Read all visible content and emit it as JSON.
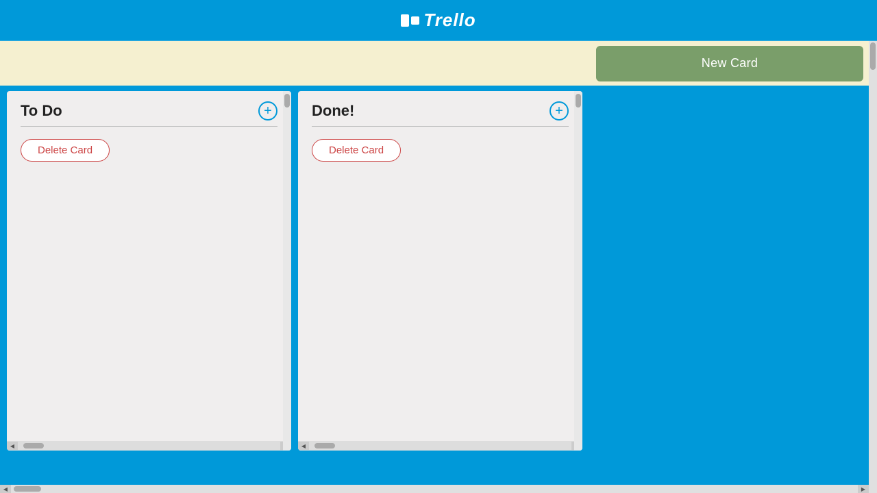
{
  "header": {
    "logo_text": "Trello"
  },
  "toolbar": {
    "new_card_label": "New Card",
    "background_color": "#f5f0d0"
  },
  "board": {
    "background_color": "#0099d9",
    "columns": [
      {
        "id": "todo",
        "title": "To Do",
        "delete_button_label": "Delete Card"
      },
      {
        "id": "done",
        "title": "Done!",
        "delete_button_label": "Delete Card"
      }
    ]
  },
  "colors": {
    "header_bg": "#0099d9",
    "toolbar_bg": "#f5f0d0",
    "new_card_bg": "#7a9e6a",
    "column_bg": "#f0eeee",
    "add_icon_color": "#0099d9",
    "delete_btn_color": "#cc4444"
  }
}
